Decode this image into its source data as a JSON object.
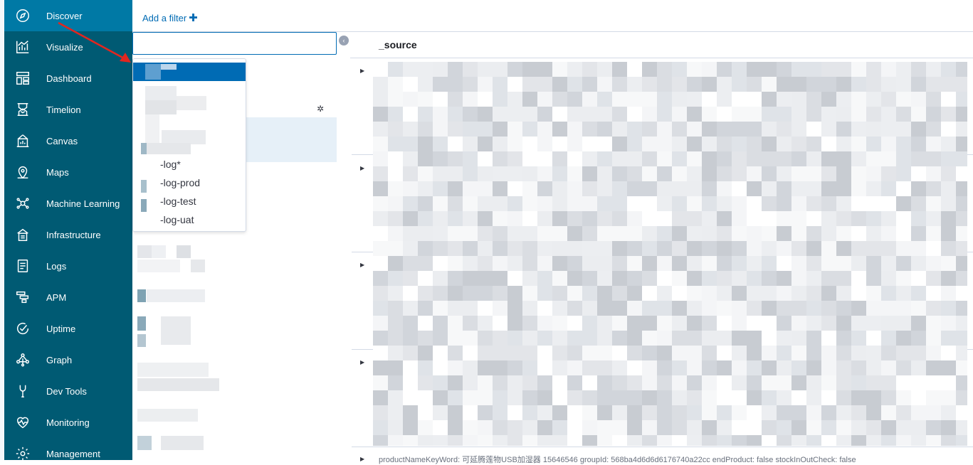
{
  "sidebar": {
    "items": [
      {
        "label": "Discover",
        "icon": "compass-icon",
        "active": true
      },
      {
        "label": "Visualize",
        "icon": "visualize-icon"
      },
      {
        "label": "Dashboard",
        "icon": "dashboard-icon"
      },
      {
        "label": "Timelion",
        "icon": "timelion-icon"
      },
      {
        "label": "Canvas",
        "icon": "canvas-icon"
      },
      {
        "label": "Maps",
        "icon": "maps-icon"
      },
      {
        "label": "Machine Learning",
        "icon": "machine-learning-icon"
      },
      {
        "label": "Infrastructure",
        "icon": "infrastructure-icon"
      },
      {
        "label": "Logs",
        "icon": "logs-icon"
      },
      {
        "label": "APM",
        "icon": "apm-icon"
      },
      {
        "label": "Uptime",
        "icon": "uptime-icon"
      },
      {
        "label": "Graph",
        "icon": "graph-icon"
      },
      {
        "label": "Dev Tools",
        "icon": "dev-tools-icon"
      },
      {
        "label": "Monitoring",
        "icon": "monitoring-icon"
      },
      {
        "label": "Management",
        "icon": "gear-icon"
      }
    ]
  },
  "topbar": {
    "add_filter_label": "Add a filter",
    "add_filter_plus": "✚"
  },
  "index_pattern": {
    "search_value": "",
    "options": [
      "-log*",
      "-log-prod",
      "-log-test",
      "-log-uat"
    ]
  },
  "content": {
    "column_header": "_source",
    "last_row_text": "productNameKeyWord: 可延腾莲物USB加湿器 15646546 groupId: 568ba4d6d6d6176740a22cc endProduct: false stockInOutCheck: false"
  },
  "colors": {
    "sidebar_bg": "#005a73",
    "sidebar_active": "#0079a5",
    "accent": "#006bb4",
    "annotation_arrow": "#e3261f"
  }
}
